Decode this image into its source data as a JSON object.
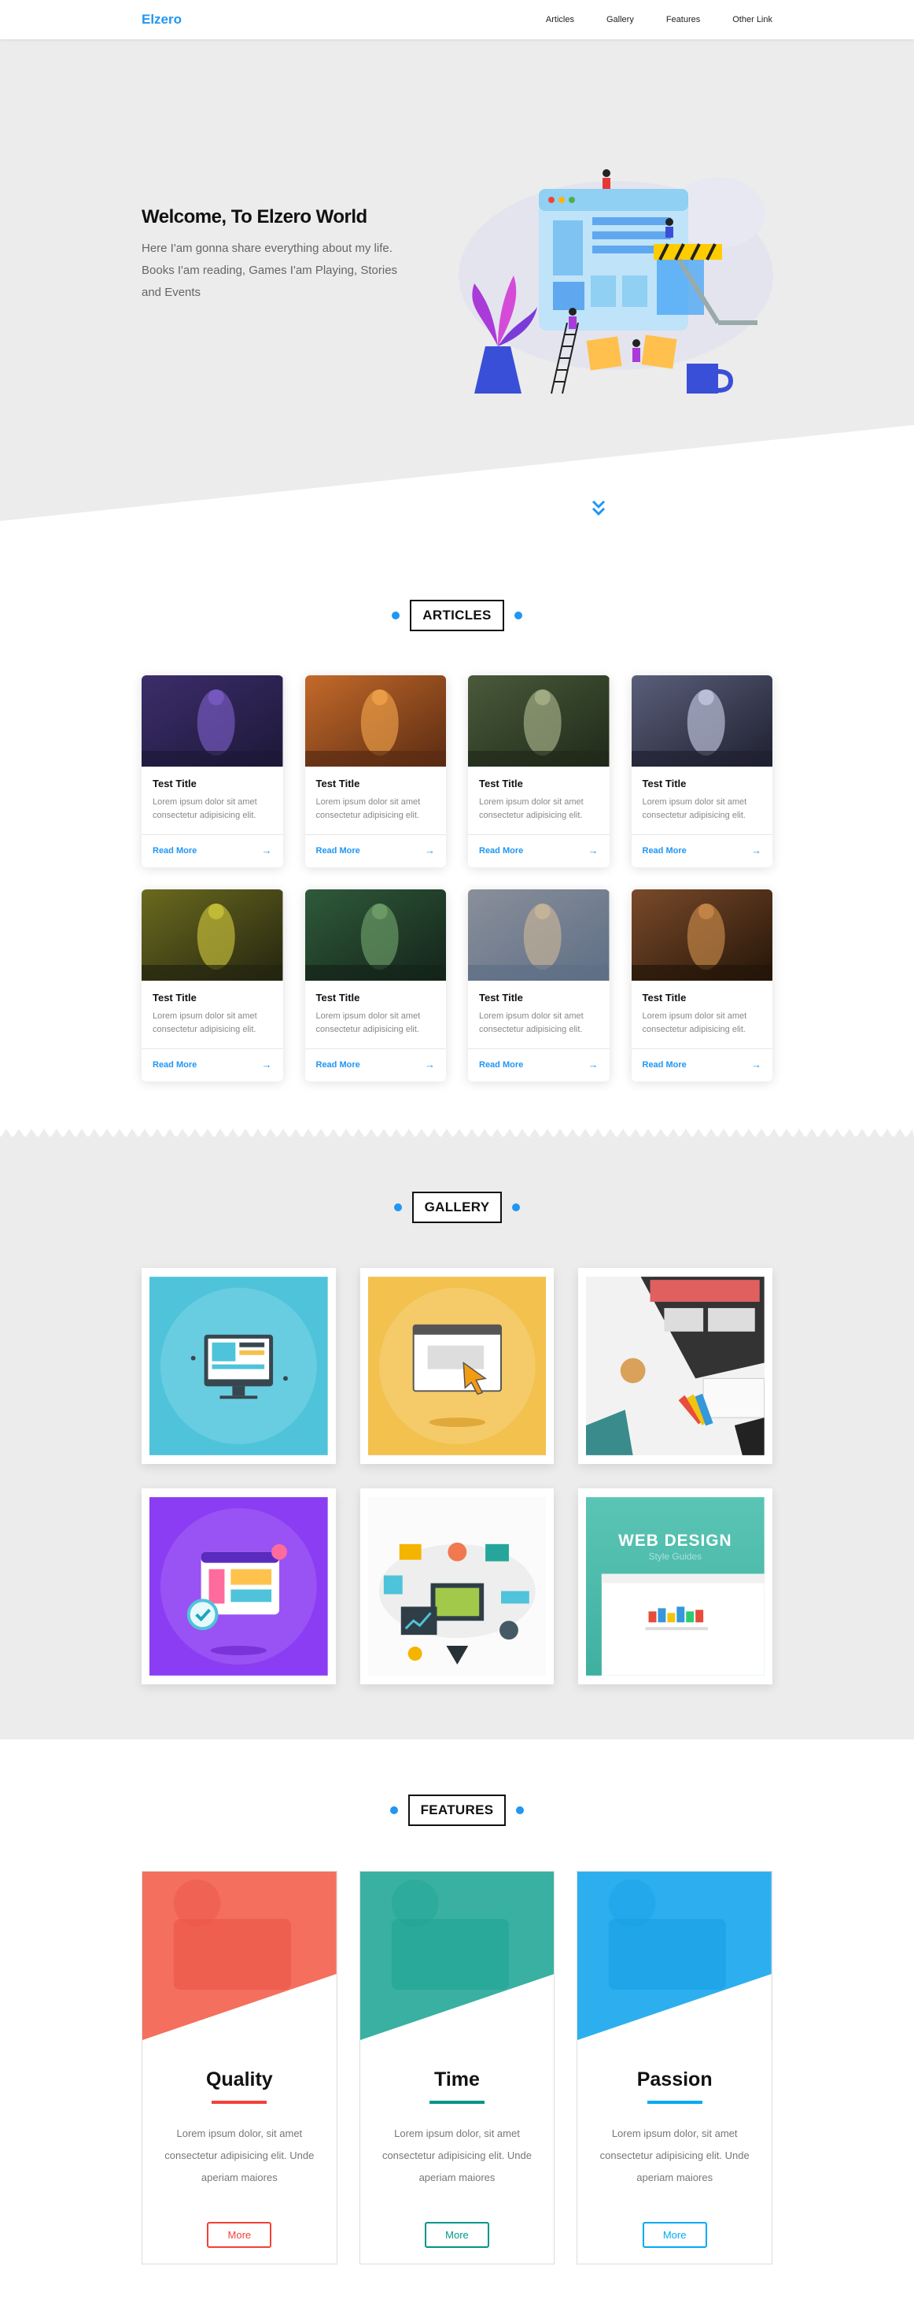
{
  "header": {
    "logo": "Elzero",
    "nav": [
      "Articles",
      "Gallery",
      "Features",
      "Other Link"
    ]
  },
  "landing": {
    "title": "Welcome, To Elzero World",
    "description": "Here I'am gonna share everything about my life. Books I'am reading, Games I'am Playing, Stories and Events"
  },
  "articles": {
    "title": "Articles",
    "cards": [
      {
        "title": "Test Title",
        "text": "Lorem ipsum dolor sit amet consectetur adipisicing elit.",
        "link": "Read More"
      },
      {
        "title": "Test Title",
        "text": "Lorem ipsum dolor sit amet consectetur adipisicing elit.",
        "link": "Read More"
      },
      {
        "title": "Test Title",
        "text": "Lorem ipsum dolor sit amet consectetur adipisicing elit.",
        "link": "Read More"
      },
      {
        "title": "Test Title",
        "text": "Lorem ipsum dolor sit amet consectetur adipisicing elit.",
        "link": "Read More"
      },
      {
        "title": "Test Title",
        "text": "Lorem ipsum dolor sit amet consectetur adipisicing elit.",
        "link": "Read More"
      },
      {
        "title": "Test Title",
        "text": "Lorem ipsum dolor sit amet consectetur adipisicing elit.",
        "link": "Read More"
      },
      {
        "title": "Test Title",
        "text": "Lorem ipsum dolor sit amet consectetur adipisicing elit.",
        "link": "Read More"
      },
      {
        "title": "Test Title",
        "text": "Lorem ipsum dolor sit amet consectetur adipisicing elit.",
        "link": "Read More"
      }
    ]
  },
  "gallery": {
    "title": "Gallery",
    "web_design_caption": "WEB DESIGN",
    "web_design_subcaption": "Style Guides"
  },
  "features": {
    "title": "Features",
    "items": [
      {
        "title": "Quality",
        "text": "Lorem ipsum dolor, sit amet consectetur adipisicing elit. Unde aperiam maiores",
        "button": "More",
        "color": "#f44036"
      },
      {
        "title": "Time",
        "text": "Lorem ipsum dolor, sit amet consectetur adipisicing elit. Unde aperiam maiores",
        "button": "More",
        "color": "#009688"
      },
      {
        "title": "Passion",
        "text": "Lorem ipsum dolor, sit amet consectetur adipisicing elit. Unde aperiam maiores",
        "button": "More",
        "color": "#03a9f4"
      }
    ]
  },
  "colors": {
    "accent": "#2196f3",
    "landing_bg": "#ececec"
  }
}
